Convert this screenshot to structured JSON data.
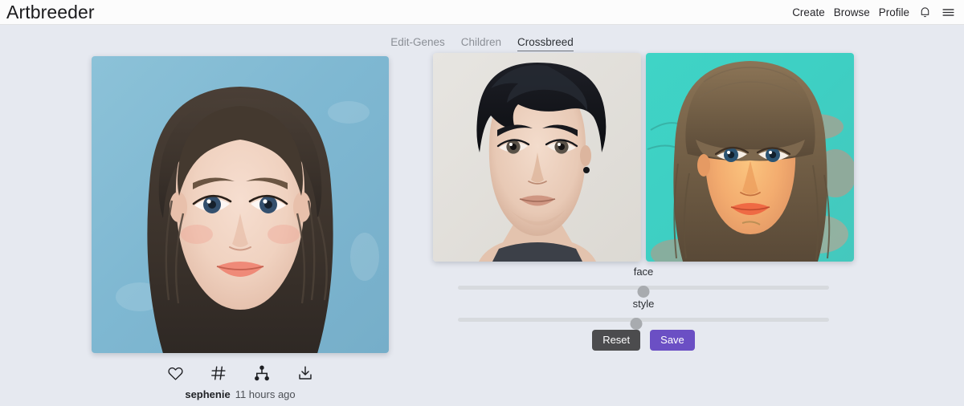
{
  "header": {
    "brand": "Artbreeder",
    "nav": [
      {
        "label": "Create",
        "name": "nav-create"
      },
      {
        "label": "Browse",
        "name": "nav-browse"
      },
      {
        "label": "Profile",
        "name": "nav-profile"
      }
    ],
    "icons": [
      {
        "name": "notification-bell-icon"
      },
      {
        "name": "hamburger-menu-icon"
      }
    ]
  },
  "tabs": [
    {
      "label": "Edit-Genes",
      "active": false
    },
    {
      "label": "Children",
      "active": false
    },
    {
      "label": "Crossbreed",
      "active": true
    }
  ],
  "child": {
    "alt": "crossbred portrait of a young girl with dark hair on blue background",
    "actions": [
      {
        "label": "like",
        "icon": "heart-icon"
      },
      {
        "label": "tags",
        "icon": "hash-icon"
      },
      {
        "label": "lineage",
        "icon": "family-tree-icon"
      },
      {
        "label": "download",
        "icon": "download-icon"
      }
    ],
    "author": "sephenie",
    "timestamp": "11 hours ago"
  },
  "crossbreed": {
    "parents": [
      {
        "name": "parent-image-left",
        "alt": "portrait of a young man with dark wavy hair on beige background"
      },
      {
        "name": "parent-image-right",
        "alt": "portrait of a young child with bangs on turquoise background"
      }
    ],
    "sliders": [
      {
        "label": "face",
        "value": 50
      },
      {
        "label": "style",
        "value": 48
      }
    ],
    "buttons": {
      "reset": "Reset",
      "save": "Save"
    }
  },
  "colors": {
    "page_background": "#e6e9f0",
    "header_background": "#fcfcfc",
    "save_button": "#6b4fc4",
    "reset_button": "#4c4c4e",
    "slider_track": "#d7dade",
    "slider_thumb": "#a8abaf",
    "tab_active_text": "#2e3136",
    "tab_inactive_text": "#8b8f96"
  }
}
